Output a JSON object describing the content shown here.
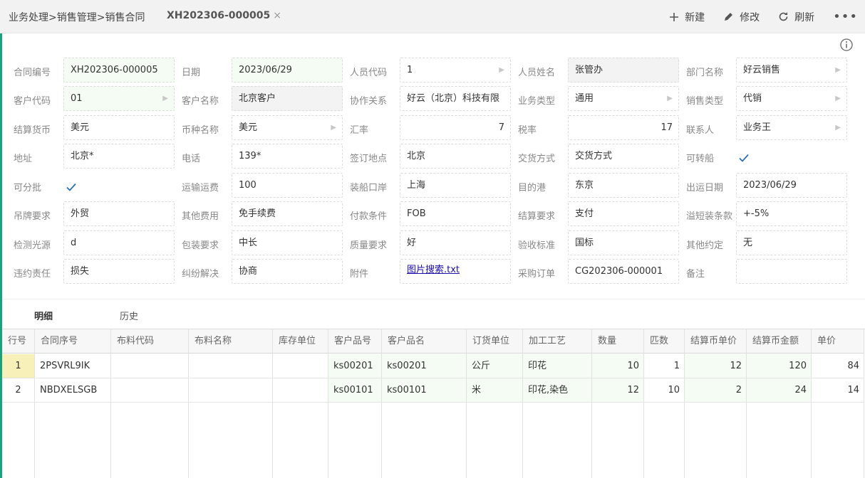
{
  "header": {
    "breadcrumb": [
      "业务处理",
      "销售管理",
      "销售合同"
    ],
    "breadcrumb_sep": ">",
    "doc_tab": "XH202306-000005",
    "close_glyph": "×",
    "toolbar": {
      "new_label": "新建",
      "edit_label": "修改",
      "refresh_label": "刷新",
      "more_label": "•••"
    }
  },
  "form": {
    "row1": {
      "contract_no_label": "合同编号",
      "contract_no": "XH202306-000005",
      "date_label": "日期",
      "date": "2023/06/29",
      "staff_code_label": "人员代码",
      "staff_code": "1",
      "staff_name_label": "人员姓名",
      "staff_name": "张管办",
      "dept_label": "部门名称",
      "dept": "好云销售"
    },
    "row2": {
      "cust_code_label": "客户代码",
      "cust_code": "01",
      "cust_name_label": "客户名称",
      "cust_name": "北京客户",
      "partner_label": "协作关系",
      "partner": "好云（北京）科技有限",
      "biz_type_label": "业务类型",
      "biz_type": "通用",
      "sale_type_label": "销售类型",
      "sale_type": "代销"
    },
    "row3": {
      "settle_cur_label": "结算货币",
      "settle_cur": "美元",
      "cur_name_label": "币种名称",
      "cur_name": "美元",
      "rate_label": "汇率",
      "rate": "7",
      "tax_label": "税率",
      "tax": "17",
      "contact_label": "联系人",
      "contact": "业务王"
    },
    "row4": {
      "addr_label": "地址",
      "addr": "北京*",
      "phone_label": "电话",
      "phone": "139*",
      "sign_place_label": "签订地点",
      "sign_place": "北京",
      "delivery_label": "交货方式",
      "delivery": "交货方式",
      "transship_label": "可转船"
    },
    "row5": {
      "partial_label": "可分批",
      "freight_label": "运输运费",
      "freight": "100",
      "load_port_label": "装船口岸",
      "load_port": "上海",
      "dest_port_label": "目的港",
      "dest_port": "东京",
      "ship_date_label": "出运日期",
      "ship_date": "2023/06/29"
    },
    "row6": {
      "tag_req_label": "吊牌要求",
      "tag_req": "外贸",
      "other_fee_label": "其他费用",
      "other_fee": "免手续费",
      "pay_terms_label": "付款条件",
      "pay_terms": "FOB",
      "settle_req_label": "结算要求",
      "settle_req": "支付",
      "tolerance_label": "溢短装条款",
      "tolerance": "+-5%"
    },
    "row7": {
      "light_label": "检测光源",
      "light": "d",
      "pack_req_label": "包装要求",
      "pack_req": "中长",
      "quality_label": "质量要求",
      "quality": "好",
      "accept_label": "验收标准",
      "accept": "国标",
      "other_agree_label": "其他约定",
      "other_agree": "无"
    },
    "row8": {
      "breach_label": "违约责任",
      "breach": "损失",
      "dispute_label": "纠纷解决",
      "dispute": "协商",
      "attach_label": "附件",
      "attach": "图片搜索.txt",
      "po_label": "采购订单",
      "po": "CG202306-000001",
      "remark_label": "备注",
      "remark": ""
    }
  },
  "tabs": [
    "明细",
    "历史"
  ],
  "grid": {
    "columns": [
      "行号",
      "合同序号",
      "布料代码",
      "布料名称",
      "库存单位",
      "客户品号",
      "客户品名",
      "订货单位",
      "加工工艺",
      "数量",
      "匹数",
      "结算币单价",
      "结算币金额",
      "单价"
    ],
    "rows": [
      [
        "1",
        "2PSVRL9IK",
        "",
        "",
        "",
        "ks00201",
        "ks00201",
        "公斤",
        "印花",
        "10",
        "1",
        "12",
        "120",
        "84"
      ],
      [
        "2",
        "NBDXELSGB",
        "",
        "",
        "",
        "ks00101",
        "ks00101",
        "米",
        "印花,染色",
        "12",
        "10",
        "2",
        "24",
        "14"
      ]
    ]
  },
  "colors": {
    "accent": "#1aa37a",
    "highlight_green": "#f4fcf3",
    "selected_row": "#f7f1b9",
    "check": "#2a6fb5"
  }
}
